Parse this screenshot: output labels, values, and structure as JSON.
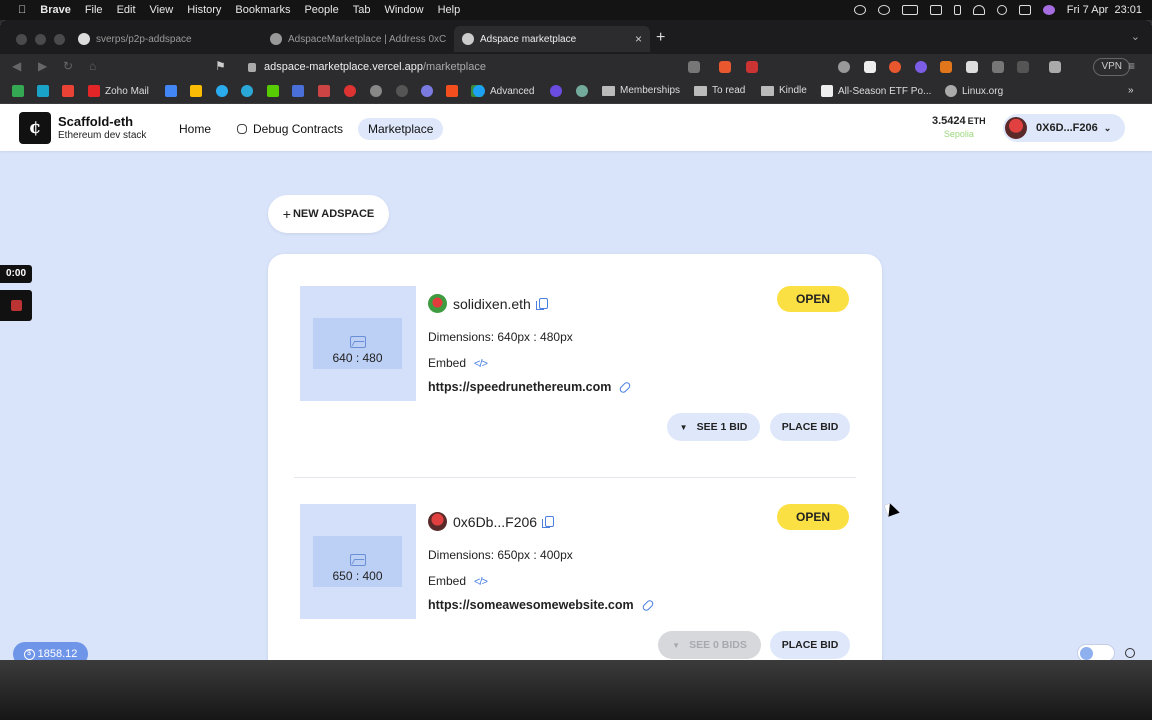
{
  "menubar": {
    "app": "Brave",
    "items": [
      "File",
      "Edit",
      "View",
      "History",
      "Bookmarks",
      "People",
      "Tab",
      "Window",
      "Help"
    ],
    "datetime": "Fri 7 Apr  23:01"
  },
  "tabs": [
    {
      "title": "sverps/p2p-addspace"
    },
    {
      "title": "AdspaceMarketplace | Address 0xC"
    },
    {
      "title": "Adspace marketplace"
    }
  ],
  "urlbar": {
    "host": "adspace-marketplace.vercel.app",
    "path": "/marketplace"
  },
  "vpn_label": "VPN",
  "bookmarks": {
    "zoho": "Zoho Mail",
    "advanced": "Advanced",
    "memberships": "Memberships",
    "toread": "To read",
    "kindle": "Kindle",
    "etf": "All-Season ETF Po...",
    "linux": "Linux.org"
  },
  "header": {
    "logo_glyph": "¢",
    "brand_name": "Scaffold-eth",
    "brand_sub": "Ethereum dev stack",
    "nav": [
      "Home",
      "Debug Contracts",
      "Marketplace"
    ],
    "balance_value": "3.5424",
    "balance_unit": "ETH",
    "network": "Sepolia",
    "account": "0X6D...F206"
  },
  "new_adspace_label": "NEW ADSPACE",
  "ads": [
    {
      "size": "640 : 480",
      "owner": "solidixen.eth",
      "dimensions": "Dimensions: 640px : 480px",
      "embed": "Embed",
      "embed_code": "</>",
      "url": "https://speedrunethereum.com",
      "status": "OPEN",
      "bids_label": "SEE 1 BID",
      "place_bid": "PLACE BID"
    },
    {
      "size": "650 : 400",
      "owner": "0x6Db...F206",
      "dimensions": "Dimensions: 650px : 400px",
      "embed": "Embed",
      "embed_code": "</>",
      "url": "https://someawesomewebsite.com",
      "status": "OPEN",
      "bids_label": "SEE 0 BIDS",
      "place_bid": "PLACE BID"
    }
  ],
  "price_badge": "1858.12",
  "recording_timer": "0:00",
  "colors": {
    "page_bg": "#d9e4fb",
    "status_open": "#fbe043",
    "button_bg": "#dfe8fb",
    "price_badge": "#6f95e8",
    "accent_blue": "#4a7fe0"
  }
}
